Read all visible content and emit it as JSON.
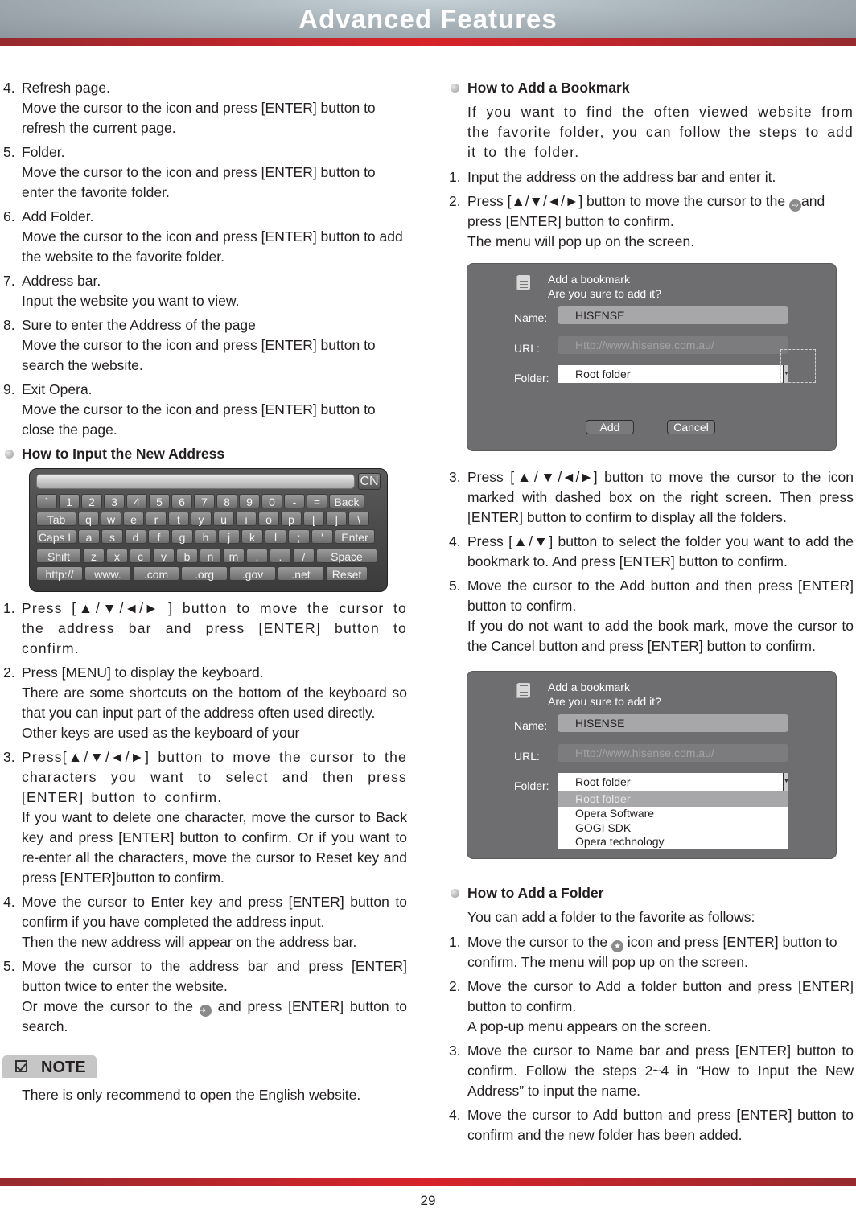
{
  "header": {
    "title": "Advanced Features"
  },
  "footer": {
    "page_number": "29"
  },
  "left": {
    "items": [
      {
        "num": "4.",
        "title": "Refresh page.",
        "body": "Move the cursor to the icon and press [ENTER] button to refresh the current page."
      },
      {
        "num": "5.",
        "title": "Folder.",
        "body": "Move the cursor to the icon and press [ENTER] button to enter the favorite folder."
      },
      {
        "num": "6.",
        "title": "Add Folder.",
        "body": "Move the cursor to the icon and press [ENTER] button to add the website to the favorite folder."
      },
      {
        "num": "7.",
        "title": "Address bar.",
        "body": "Input the website you want to view."
      },
      {
        "num": "8.",
        "title": "Sure to enter the Address of the page",
        "body": "Move the cursor to the icon and press [ENTER] button to search the website."
      },
      {
        "num": "9.",
        "title": "Exit Opera.",
        "body": "Move the cursor to the icon and press [ENTER] button to close the page."
      }
    ],
    "section_title": "How to Input the New Address",
    "keyboard": {
      "cn_label": "CN",
      "rows": [
        [
          "`",
          "1",
          "2",
          "3",
          "4",
          "5",
          "6",
          "7",
          "8",
          "9",
          "0",
          "-",
          "=",
          "Back"
        ],
        [
          "Tab",
          "q",
          "w",
          "e",
          "r",
          "t",
          "y",
          "u",
          "i",
          "o",
          "p",
          "[",
          "]",
          "\\"
        ],
        [
          "Caps L",
          "a",
          "s",
          "d",
          "f",
          "g",
          "h",
          "j",
          "k",
          "l",
          ";",
          "'",
          "Enter"
        ],
        [
          "Shift",
          "z",
          "x",
          "c",
          "v",
          "b",
          "n",
          "m",
          ",",
          ".",
          "/",
          "Space"
        ],
        [
          "http://",
          "www.",
          ".com",
          ".org",
          ".gov",
          ".net",
          "Reset"
        ]
      ]
    },
    "steps": [
      {
        "num": "1.",
        "lines": [
          "Press [▲/▼/◄/► ] button to move the cursor to the address bar and press [ENTER] button to confirm."
        ]
      },
      {
        "num": "2.",
        "lines": [
          "Press [MENU] to display the keyboard.",
          "There are some shortcuts on the bottom of the  keyboard so that you can input part of the address often used directly.",
          "Other keys are used as the keyboard of your"
        ]
      },
      {
        "num": "3.",
        "lines": [
          "Press[▲/▼/◄/►] button to move the cursor to the characters you want to select and then press [ENTER] button  to confirm.",
          "If you want to delete one character, move the cursor to Back key and press [ENTER] button to confirm. Or if you want to re-enter all the characters, move the cursor to Reset key and press [ENTER]button to confirm."
        ]
      },
      {
        "num": "4.",
        "lines": [
          "Move the cursor to Enter key and press [ENTER] button to confirm if you have completed the address input.",
          "Then the new address will appear on the address bar."
        ]
      },
      {
        "num": "5.",
        "lines": [
          "Move the cursor to the address bar and press [ENTER] button twice to enter the website."
        ],
        "extra_before": "Or move the cursor to the",
        "extra_after": "and press [ENTER] button to search."
      }
    ],
    "note": {
      "label": "NOTE",
      "text": "There is only recommend to open the English website."
    }
  },
  "right": {
    "bookmark_title": "How to Add a Bookmark",
    "bookmark_intro": "If you want to find the often viewed website from the favorite folder, you can follow the steps to add it to the folder.",
    "bookmark_step1": "Input the address on the address bar and enter it.",
    "bookmark_step2_before": "Press [▲/▼/◄/►] button to move the cursor to the",
    "bookmark_step2_after": "and press [ENTER] button to confirm.",
    "bookmark_step2_line2": "The menu will pop up on the screen.",
    "dialog": {
      "title": "Add a bookmark",
      "subtitle": "Are you sure to add it?",
      "name_label": "Name:",
      "name_value": "HISENSE",
      "url_label": "URL:",
      "url_value": "Http://www.hisense.com.au/",
      "folder_label": "Folder:",
      "folder_value": "Root folder",
      "add_label": "Add",
      "cancel_label": "Cancel",
      "folder_options": [
        "Root folder",
        "Opera Software",
        "GOGI SDK",
        "Opera technology"
      ],
      "selected_option": "Root folder"
    },
    "bookmark_steps_more": [
      {
        "num": "3.",
        "lines": [
          "Press [▲/▼/◄/►] button to move the cursor to the icon marked with dashed box on the right screen. Then press [ENTER] button to confirm to display all the folders."
        ]
      },
      {
        "num": "4.",
        "lines": [
          "Press [▲/▼] button  to select the folder you want to add the bookmark to. And press [ENTER] button to confirm."
        ]
      },
      {
        "num": "5.",
        "lines": [
          "Move the cursor to the Add button and then press [ENTER] button to confirm.",
          "If you do not want to add the book mark, move the cursor to the Cancel button and press [ENTER] button to confirm."
        ]
      }
    ],
    "folder_title": "How to Add a Folder",
    "folder_intro": "You can add a folder to the favorite as follows:",
    "folder_step1_before": "Move the cursor to the",
    "folder_step1_after": "icon and press [ENTER] button to confirm. The menu will pop up on the screen.",
    "folder_steps": [
      {
        "num": "2.",
        "lines": [
          "Move the cursor to Add a folder button and press [ENTER] button to confirm.",
          "A pop-up menu appears on the screen."
        ]
      },
      {
        "num": "3.",
        "lines": [
          "Move the cursor to Name bar and press [ENTER] button to confirm. Follow the steps 2~4 in “How to Input the New Address” to input the name."
        ]
      },
      {
        "num": "4.",
        "lines": [
          "Move the cursor to Add button and press [ENTER] button to confirm and the new folder has been added."
        ]
      }
    ]
  }
}
